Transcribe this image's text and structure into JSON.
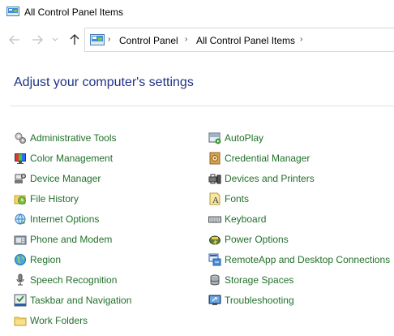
{
  "window": {
    "title": "All Control Panel Items"
  },
  "address": {
    "crumbs": [
      "Control Panel",
      "All Control Panel Items"
    ]
  },
  "heading": "Adjust your computer's settings",
  "items_left": [
    {
      "label": "Administrative Tools",
      "icon": "admin-tools-icon"
    },
    {
      "label": "Color Management",
      "icon": "color-management-icon"
    },
    {
      "label": "Device Manager",
      "icon": "device-manager-icon"
    },
    {
      "label": "File History",
      "icon": "file-history-icon"
    },
    {
      "label": "Internet Options",
      "icon": "internet-options-icon"
    },
    {
      "label": "Phone and Modem",
      "icon": "phone-modem-icon"
    },
    {
      "label": "Region",
      "icon": "region-icon"
    },
    {
      "label": "Speech Recognition",
      "icon": "speech-recognition-icon"
    },
    {
      "label": "Taskbar and Navigation",
      "icon": "taskbar-icon"
    },
    {
      "label": "Work Folders",
      "icon": "work-folders-icon"
    }
  ],
  "items_right": [
    {
      "label": "AutoPlay",
      "icon": "autoplay-icon"
    },
    {
      "label": "Credential Manager",
      "icon": "credential-manager-icon"
    },
    {
      "label": "Devices and Printers",
      "icon": "devices-printers-icon"
    },
    {
      "label": "Fonts",
      "icon": "fonts-icon"
    },
    {
      "label": "Keyboard",
      "icon": "keyboard-icon"
    },
    {
      "label": "Power Options",
      "icon": "power-options-icon"
    },
    {
      "label": "RemoteApp and Desktop Connections",
      "icon": "remoteapp-icon"
    },
    {
      "label": "Storage Spaces",
      "icon": "storage-spaces-icon"
    },
    {
      "label": "Troubleshooting",
      "icon": "troubleshooting-icon"
    }
  ],
  "colors": {
    "link": "#21702a",
    "heading": "#1e3287"
  }
}
